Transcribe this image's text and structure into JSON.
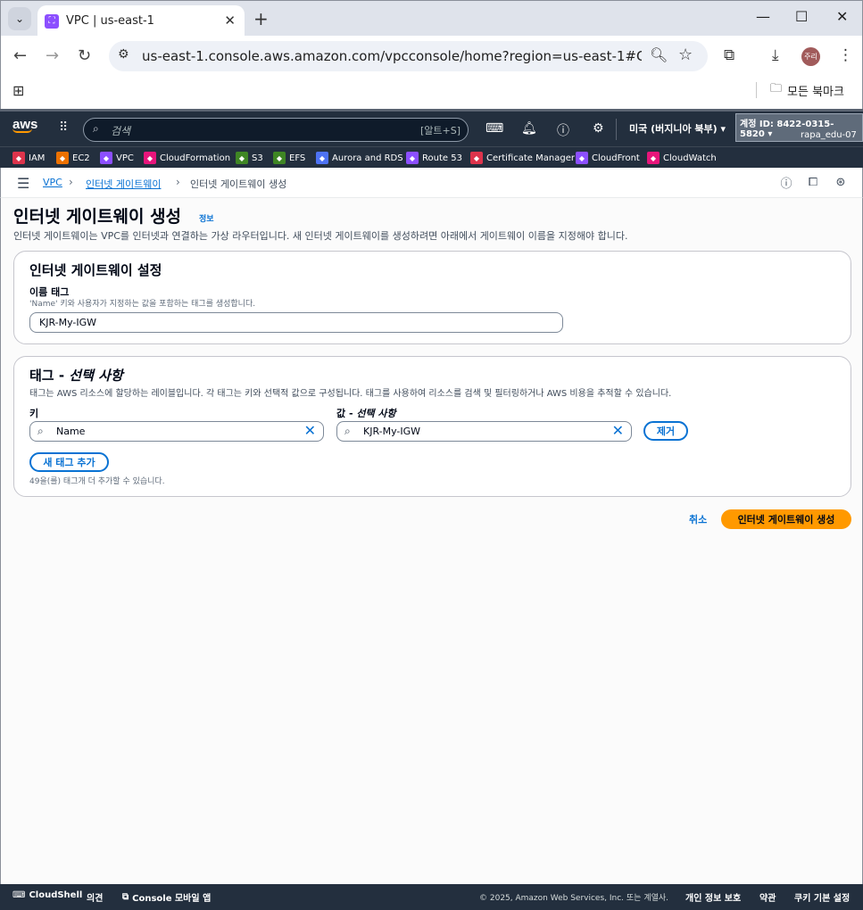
{
  "browser": {
    "tab_title": "VPC | us-east-1",
    "url": "us-east-1.console.aws.amazon.com/vpcconsole/home?region=us-east-1#CreateIntern...",
    "profile_label": "주리",
    "bookmarks_label": "모든 북마크"
  },
  "aws_header": {
    "search_placeholder": "검색",
    "search_shortcut": "[알트+S]",
    "region": "미국 (버지니아 북부) ▾",
    "account": "계정 ID: 8422-0315-5820 ▾",
    "user": "rapa_edu-07"
  },
  "favorites": [
    {
      "label": "IAM",
      "color": "#dd344c"
    },
    {
      "label": "EC2",
      "color": "#ed7100"
    },
    {
      "label": "VPC",
      "color": "#8c4fff"
    },
    {
      "label": "CloudFormation",
      "color": "#e7157b"
    },
    {
      "label": "S3",
      "color": "#3f8624"
    },
    {
      "label": "EFS",
      "color": "#3f8624"
    },
    {
      "label": "Aurora and RDS",
      "color": "#4d72f3"
    },
    {
      "label": "Route 53",
      "color": "#8c4fff"
    },
    {
      "label": "Certificate Manager",
      "color": "#dd344c"
    },
    {
      "label": "CloudFront",
      "color": "#8c4fff"
    },
    {
      "label": "CloudWatch",
      "color": "#e7157b"
    }
  ],
  "breadcrumb": {
    "items": [
      "VPC",
      "인터넷 게이트웨이",
      "인터넷 게이트웨이 생성"
    ]
  },
  "page": {
    "title": "인터넷 게이트웨이 생성",
    "info": "정보",
    "description": "인터넷 게이트웨이는 VPC를 인터넷과 연결하는 가상 라우터입니다. 새 인터넷 게이트웨이를 생성하려면 아래에서 게이트웨이 이름을 지정해야 합니다."
  },
  "settings_panel": {
    "title": "인터넷 게이트웨이 설정",
    "name_tag_label": "이름 태그",
    "name_tag_desc": "'Name' 키와 사용자가 지정하는 값을 포함하는 태그를 생성합니다.",
    "name_tag_value": "KJR-My-IGW"
  },
  "tags_panel": {
    "title_prefix": "태그 - ",
    "title_optional": "선택 사항",
    "description": "태그는 AWS 리소스에 할당하는 레이블입니다. 각 태그는 키와 선택적 값으로 구성됩니다. 태그를 사용하여 리소스를 검색 및 필터링하거나 AWS 비용을 추적할 수 있습니다.",
    "key_label": "키",
    "value_label_prefix": "값 - ",
    "value_label_optional": "선택 사항",
    "key_value": "Name",
    "value_value": "KJR-My-IGW",
    "remove_button": "제거",
    "add_button": "새 태그 추가",
    "hint": "49을(를) 태그개 더 추가할 수 있습니다."
  },
  "actions": {
    "cancel": "취소",
    "create": "인터넷 게이트웨이 생성"
  },
  "footer": {
    "cloudshell": "CloudShell",
    "feedback": "의견",
    "mobile_app": "Console 모바일 앱",
    "copyright": "© 2025, Amazon Web Services, Inc. 또는 계열사.",
    "privacy": "개인 정보 보호",
    "terms": "약관",
    "cookies": "쿠키 기본 설정"
  }
}
